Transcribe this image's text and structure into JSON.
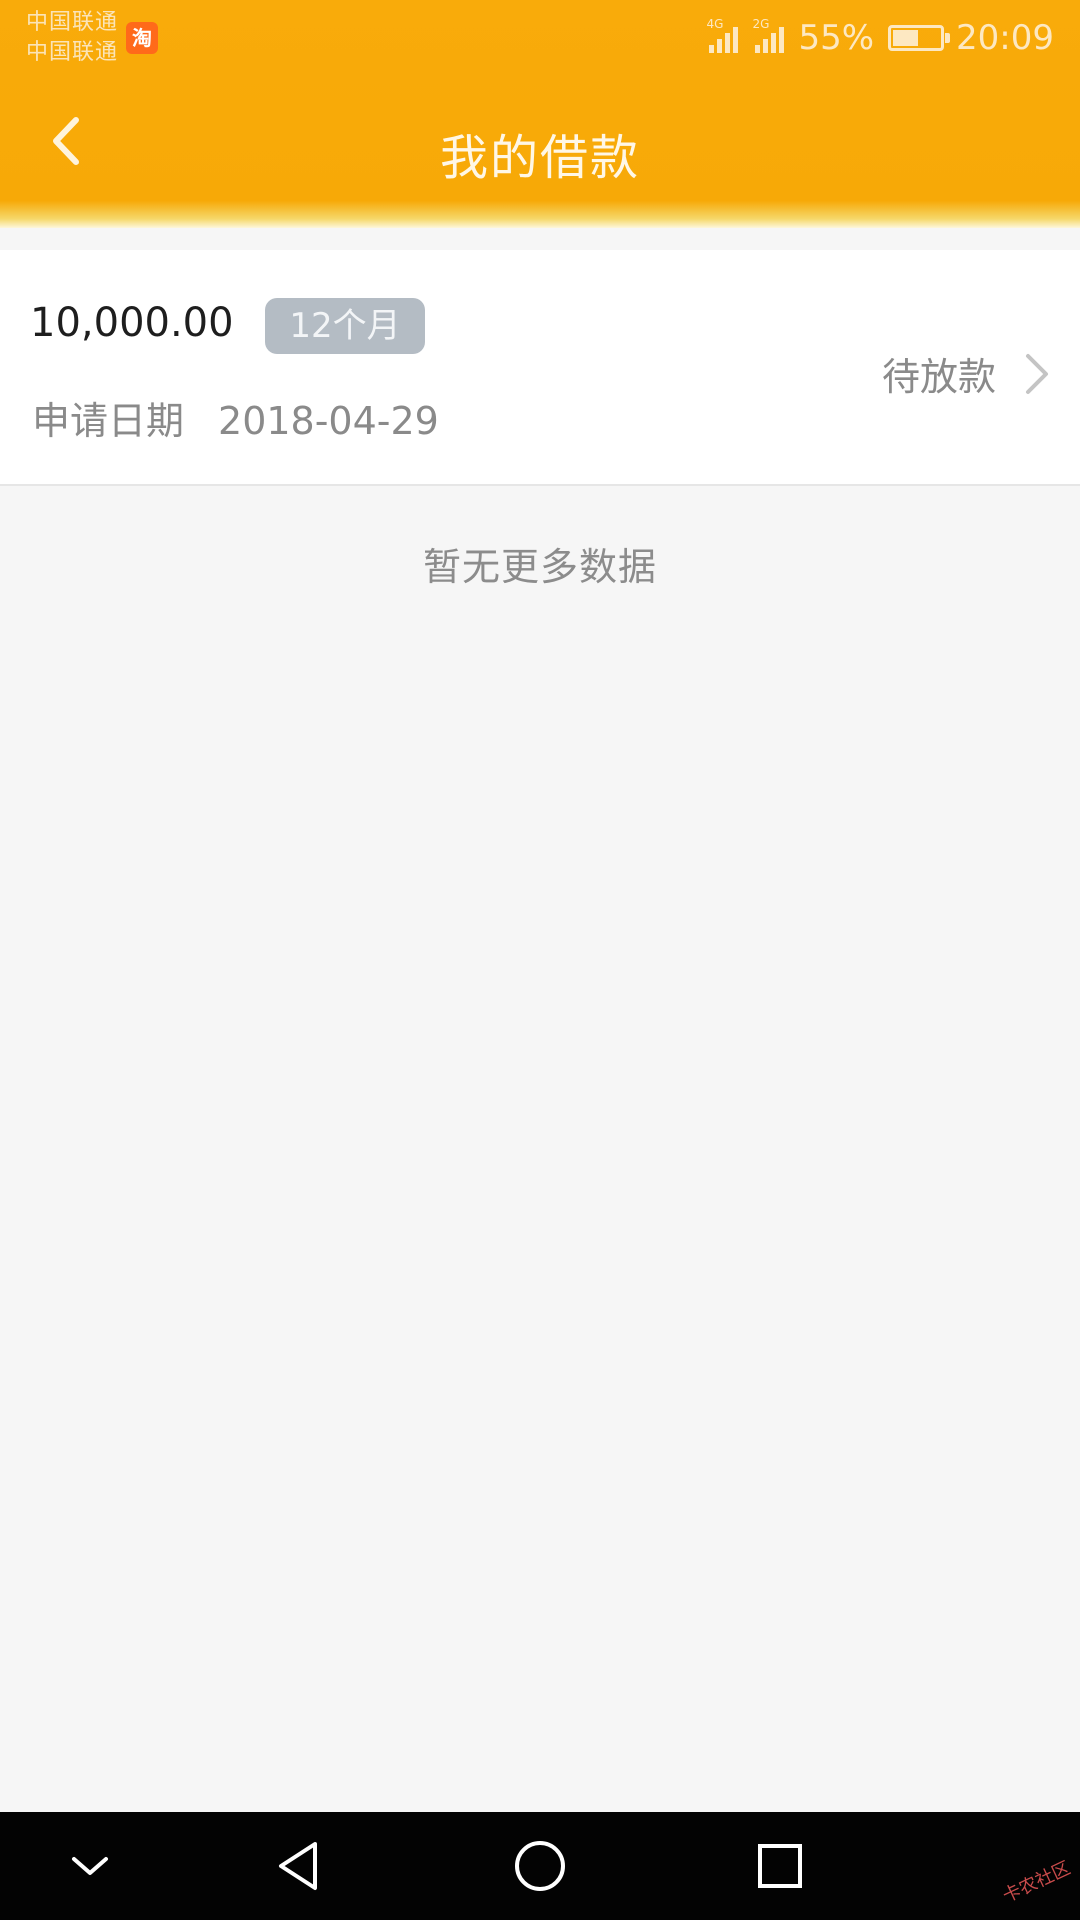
{
  "status_bar": {
    "carrier_1": "中国联通",
    "carrier_2": "中国联通",
    "app_badge": "淘",
    "sim1_network": "4G",
    "sim2_network": "2G",
    "battery_percent": "55%",
    "battery_level": 0.55,
    "time": "20:09"
  },
  "nav": {
    "back_icon": "chevron-left-icon",
    "title": "我的借款"
  },
  "loan": {
    "amount": "10,000.00",
    "term": "12个月",
    "date_label": "申请日期",
    "date_value": "2018-04-29",
    "status": "待放款",
    "chevron_icon": "chevron-right-icon"
  },
  "list_footer": "暂无更多数据",
  "system_nav": {
    "icons": [
      "chevron-down-icon",
      "back-triangle-icon",
      "home-circle-icon",
      "recents-square-icon"
    ]
  },
  "watermark": "卡农社区",
  "colors": {
    "header": "#f9ab0a",
    "badge_bg": "#b4bcc4",
    "background": "#f6f6f6",
    "nav_bg": "#030303"
  }
}
